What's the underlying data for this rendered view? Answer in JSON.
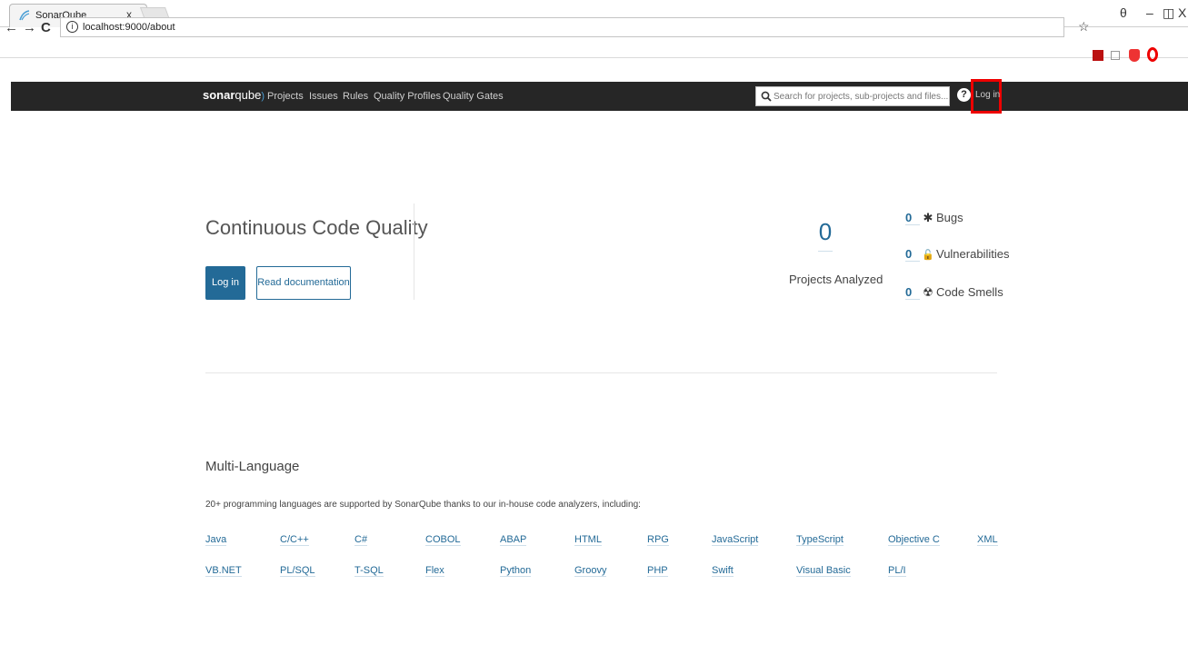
{
  "browser": {
    "tab_title": "SonarQube",
    "tab_close": "x",
    "url": "localhost:9000/about",
    "window_controls": {
      "account": "θ",
      "minimize": "–",
      "restore": "◫",
      "close": "X"
    },
    "nav_icons": {
      "back": "←",
      "forward": "→",
      "reload": "C"
    },
    "extensions": {
      "star": "☆",
      "pdf": "▲",
      "screen": "▫",
      "shield": "●",
      "opera": "O"
    }
  },
  "navbar": {
    "logo_bold": "sonar",
    "logo_light": "qube",
    "links": [
      "Projects",
      "Issues",
      "Rules",
      "Quality Profiles",
      "Quality Gates"
    ],
    "search_placeholder": "Search for projects, sub-projects and files...",
    "help": "?",
    "login": "Log in"
  },
  "hero": {
    "title": "Continuous Code Quality",
    "login_button": "Log in",
    "docs_button": "Read documentation",
    "projects_count": "0",
    "projects_label": "Projects Analyzed",
    "metrics": [
      {
        "value": "0",
        "icon": "bug-icon",
        "glyph": "✱",
        "label": "Bugs"
      },
      {
        "value": "0",
        "icon": "lock-icon",
        "glyph": "🔓",
        "label": "Vulnerabilities"
      },
      {
        "value": "0",
        "icon": "radiation-icon",
        "glyph": "☢",
        "label": "Code Smells"
      }
    ]
  },
  "multilang": {
    "title": "Multi-Language",
    "description": "20+ programming languages are supported by SonarQube thanks to our in-house code analyzers, including:",
    "languages_row1": [
      "Java",
      "C/C++",
      "C#",
      "COBOL",
      "ABAP",
      "HTML",
      "RPG",
      "JavaScript",
      "TypeScript",
      "Objective C",
      "XML"
    ],
    "languages_row2": [
      "VB.NET",
      "PL/SQL",
      "T-SQL",
      "Flex",
      "Python",
      "Groovy",
      "PHP",
      "Swift",
      "Visual Basic",
      "PL/I"
    ]
  },
  "colors": {
    "accent": "#236a97",
    "navbar": "#262626",
    "highlight": "#e00000"
  }
}
